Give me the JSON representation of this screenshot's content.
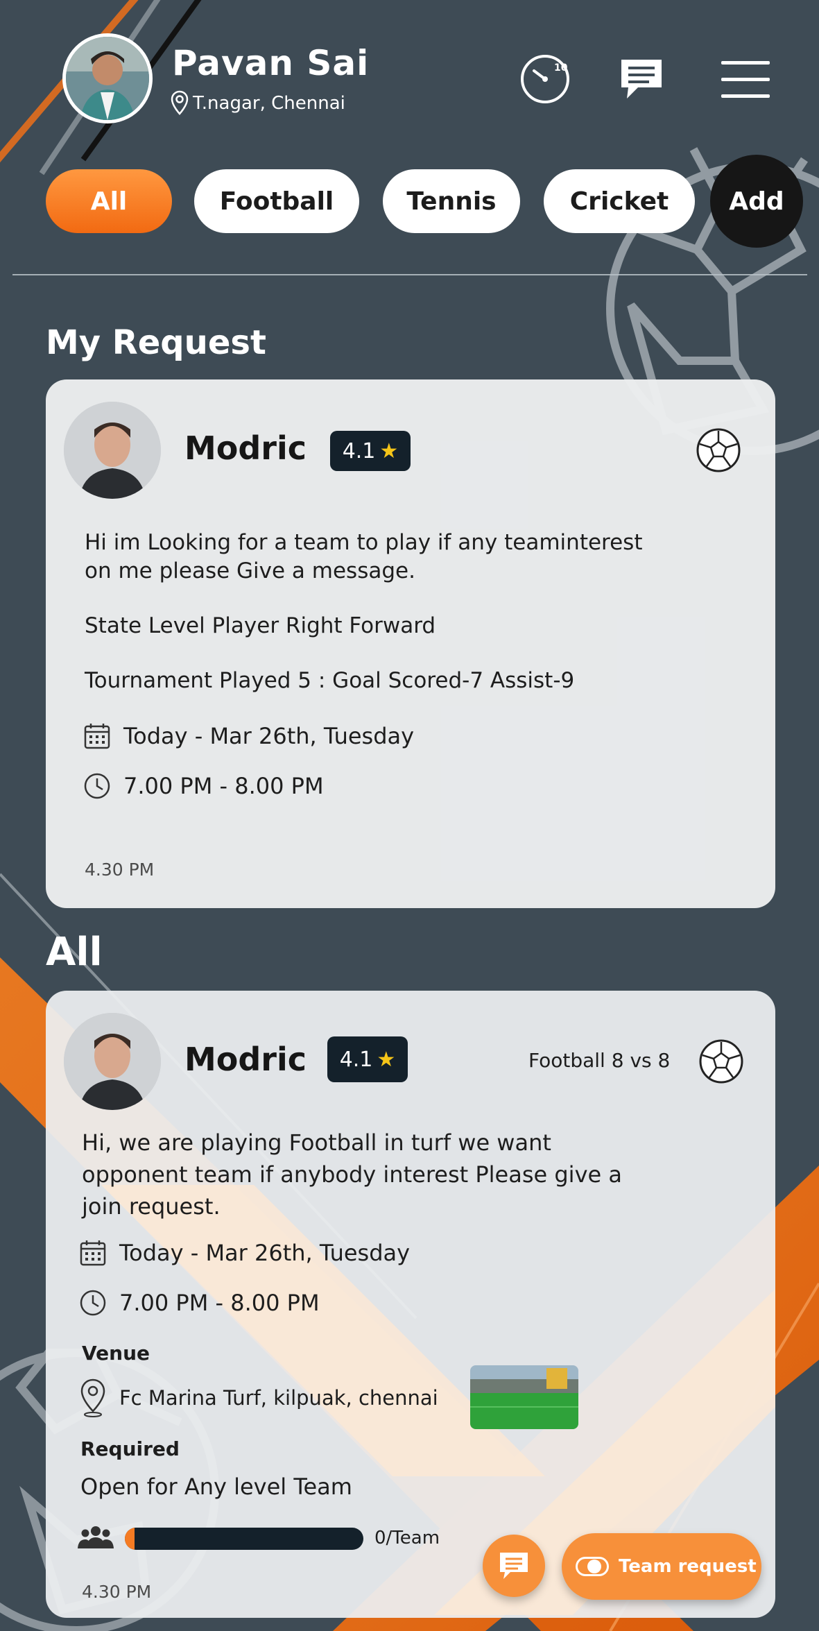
{
  "header": {
    "user_name": "Pavan Sai",
    "location": "T.nagar, Chennai",
    "timer_badge": "10"
  },
  "filters": [
    {
      "label": "All",
      "active": true
    },
    {
      "label": "Football",
      "active": false
    },
    {
      "label": "Tennis",
      "active": false
    },
    {
      "label": "Cricket",
      "active": false
    },
    {
      "label": "Add",
      "active": false
    }
  ],
  "my_request": {
    "section_title": "My Request",
    "card": {
      "name": "Modric",
      "rating": "4.1",
      "lines": [
        "Hi im Looking for a team to play if any teaminterest",
        "on me please Give a message.",
        "State Level Player Right Forward",
        "Tournament Played 5 : Goal Scored-7 Assist-9"
      ],
      "date": "Today - Mar 26th, Tuesday",
      "time": "7.00 PM - 8.00 PM",
      "posted": "4.30 PM",
      "sport_icon": "football-icon"
    }
  },
  "all": {
    "section_title": "All",
    "card": {
      "name": "Modric",
      "rating": "4.1",
      "match_type": "Football 8 vs 8",
      "lines": [
        "Hi, we are playing Football in turf we want",
        "opponent team if anybody interest Please give a",
        "join request."
      ],
      "date": "Today - Mar 26th, Tuesday",
      "time": "7.00 PM - 8.00 PM",
      "venue_label": "Venue",
      "venue": "Fc Marina Turf, kilpuak, chennai",
      "required_label": "Required",
      "required": "Open for Any level Team",
      "team_count": "0/Team",
      "team_fill_fraction": 0.04,
      "posted": "4.30 PM"
    }
  },
  "actions": {
    "team_request": "Team request"
  },
  "colors": {
    "background": "#3e4b55",
    "accent": "#f57b23",
    "dark": "#14212b",
    "card": "#eceef0"
  }
}
